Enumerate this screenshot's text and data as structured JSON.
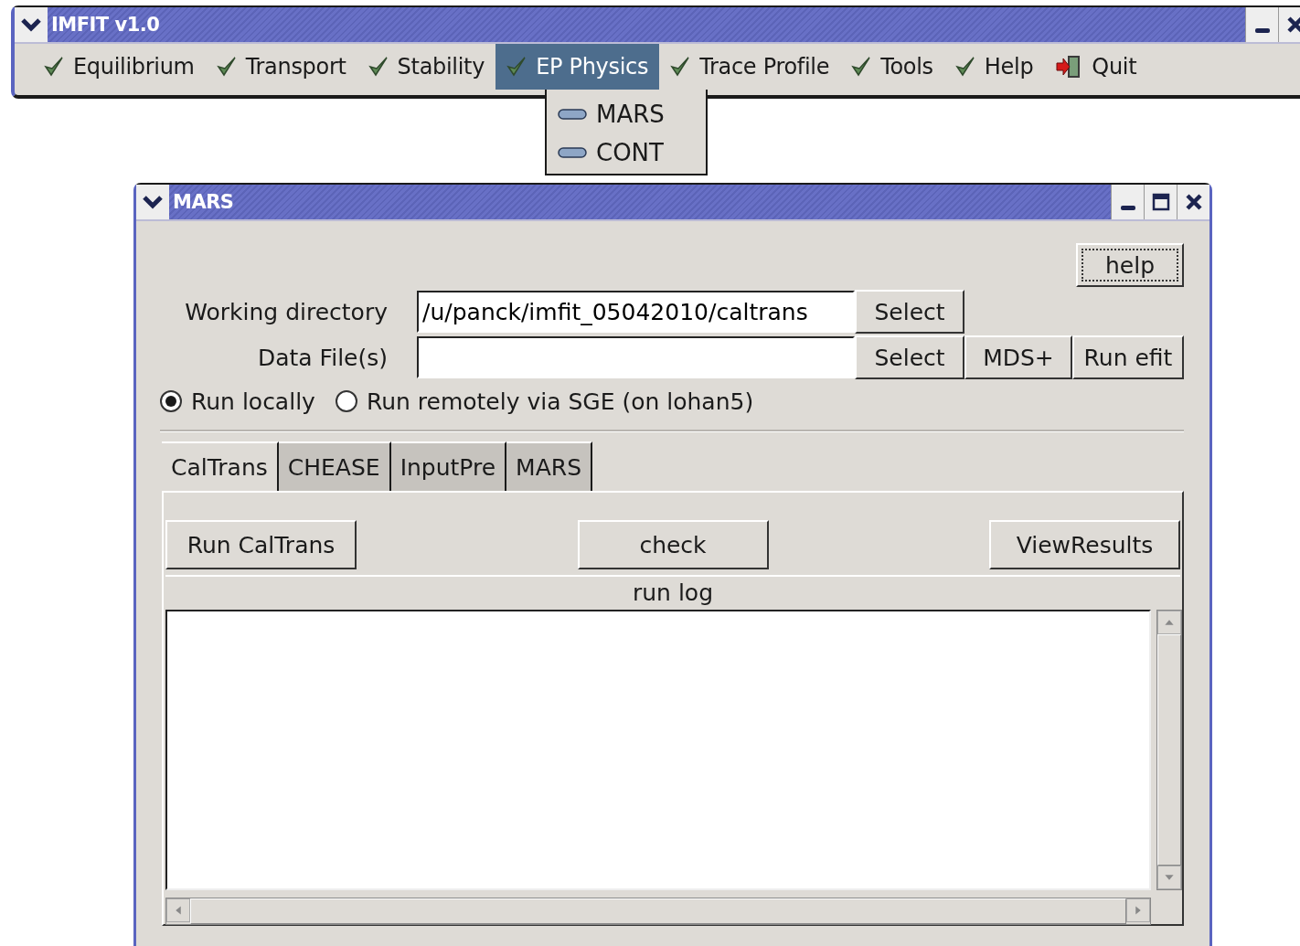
{
  "main_window": {
    "title": "IMFIT v1.0",
    "menu": [
      {
        "label": "Equilibrium",
        "kind": "check",
        "selected": false
      },
      {
        "label": "Transport",
        "kind": "check",
        "selected": false
      },
      {
        "label": "Stability",
        "kind": "check",
        "selected": false
      },
      {
        "label": "EP Physics",
        "kind": "check",
        "selected": true
      },
      {
        "label": "Trace Profile",
        "kind": "check",
        "selected": false
      },
      {
        "label": "Tools",
        "kind": "check",
        "selected": false
      },
      {
        "label": "Help",
        "kind": "check",
        "selected": false
      },
      {
        "label": "Quit",
        "kind": "exit",
        "selected": false
      }
    ]
  },
  "dropdown": {
    "items": [
      {
        "label": "MARS"
      },
      {
        "label": "CONT"
      }
    ]
  },
  "mars_window": {
    "title": "MARS",
    "help_button": "help",
    "fields": [
      {
        "label": "Working directory",
        "value": "/u/panck/imfit_05042010/caltrans",
        "buttons": [
          "Select"
        ]
      },
      {
        "label": "Data File(s)",
        "buttons": [
          "Select",
          "MDS+",
          "Run efit"
        ]
      }
    ],
    "radios": [
      {
        "label": "Run locally",
        "selected": true
      },
      {
        "label": "Run remotely via SGE (on lohan5)",
        "selected": false
      }
    ],
    "tabs": [
      {
        "label": "CalTrans",
        "selected": true
      },
      {
        "label": "CHEASE",
        "selected": false
      },
      {
        "label": "InputPre",
        "selected": false
      },
      {
        "label": "MARS",
        "selected": false
      }
    ],
    "actions": [
      "Run CalTrans",
      "check",
      "ViewResults"
    ],
    "log_title": "run log"
  }
}
